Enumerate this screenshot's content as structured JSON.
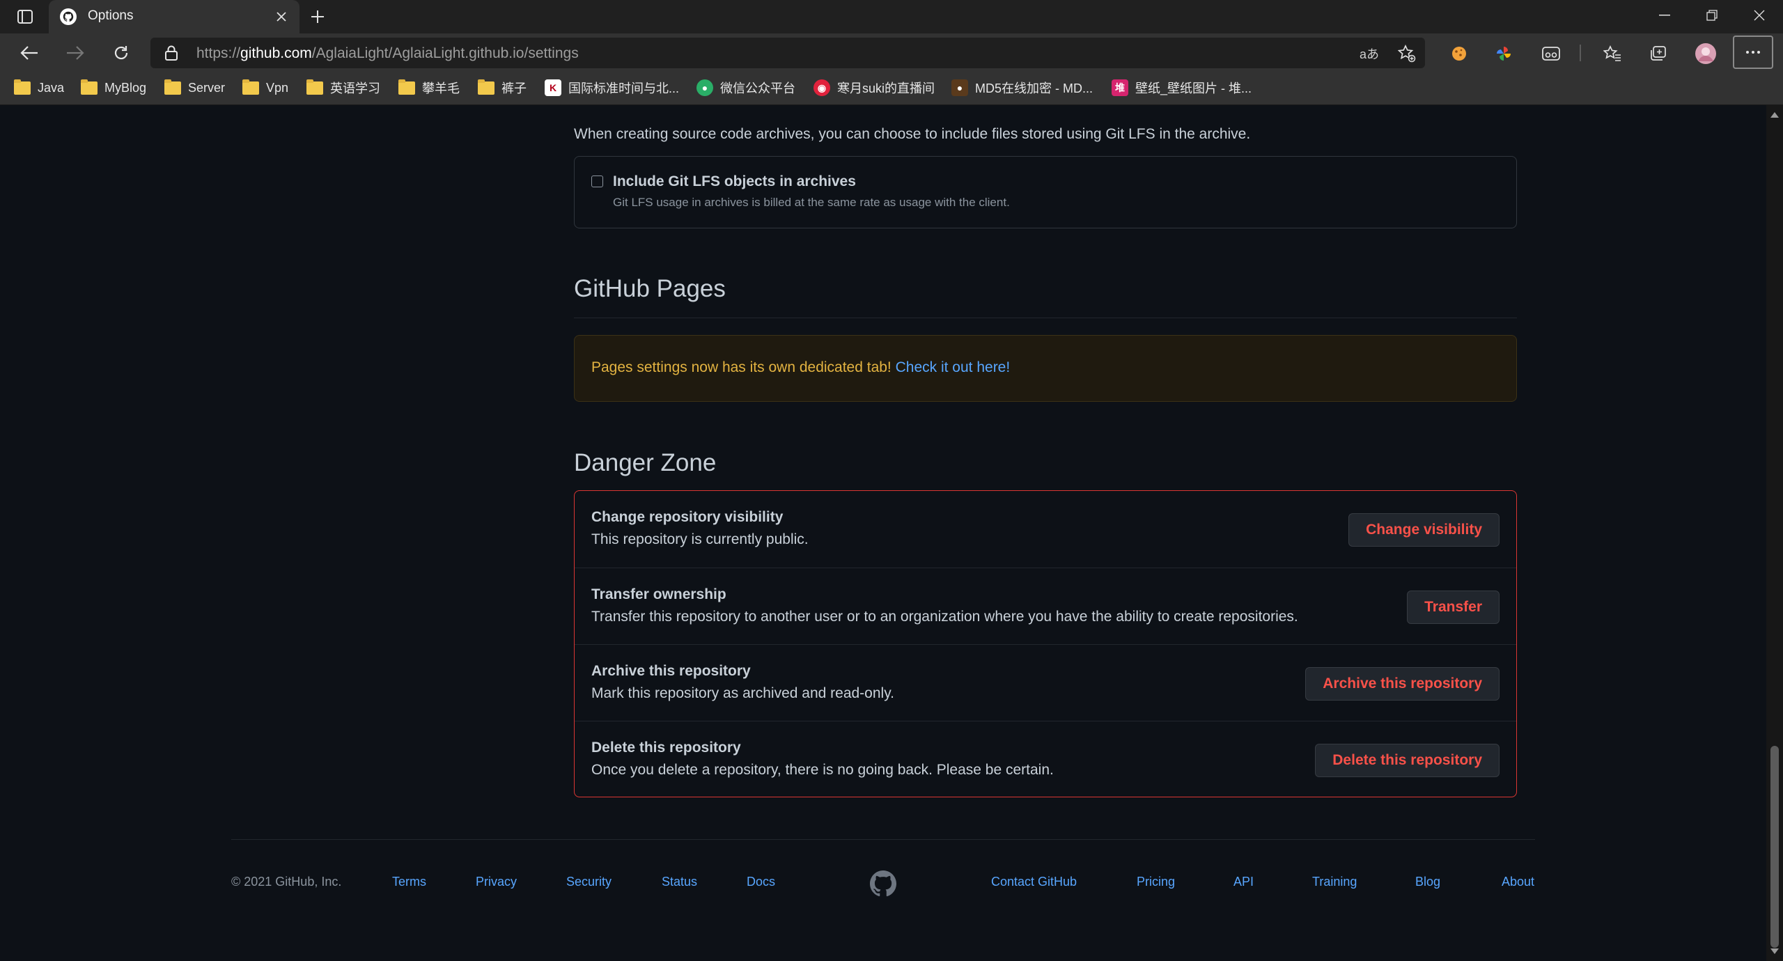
{
  "browser": {
    "tab_title": "Options",
    "url_scheme": "https://",
    "url_host": "github.com",
    "url_path": "/AglaiaLight/AglaiaLight.github.io/settings",
    "bookmarks": [
      {
        "label": "Java",
        "icon": "folder-icon"
      },
      {
        "label": "MyBlog",
        "icon": "folder-icon"
      },
      {
        "label": "Server",
        "icon": "folder-icon"
      },
      {
        "label": "Vpn",
        "icon": "folder-icon"
      },
      {
        "label": "英语学习",
        "icon": "folder-icon"
      },
      {
        "label": "攀羊毛",
        "icon": "folder-icon"
      },
      {
        "label": "裤子",
        "icon": "folder-icon"
      },
      {
        "label": "国际标准时间与北...",
        "icon": "time-site-icon"
      },
      {
        "label": "微信公众平台",
        "icon": "wechat-icon"
      },
      {
        "label": "寒月suki的直播间",
        "icon": "live-icon"
      },
      {
        "label": "MD5在线加密 - MD...",
        "icon": "md5-site-icon"
      },
      {
        "label": "壁纸_壁纸图片 - 堆...",
        "icon": "wallpaper-site-icon"
      }
    ],
    "colors": {
      "chrome_dark": "#202020",
      "chrome": "#323232"
    }
  },
  "lfs": {
    "intro": "When creating source code archives, you can choose to include files stored using Git LFS in the archive.",
    "checkbox_label": "Include Git LFS objects in archives",
    "checkbox_checked": false,
    "note": "Git LFS usage in archives is billed at the same rate as usage with the client."
  },
  "pages": {
    "heading": "GitHub Pages",
    "flash_text": "Pages settings now has its own dedicated tab! ",
    "flash_link": "Check it out here!"
  },
  "danger": {
    "heading": "Danger Zone",
    "rows": [
      {
        "title": "Change repository visibility",
        "desc": "This repository is currently public.",
        "button": "Change visibility"
      },
      {
        "title": "Transfer ownership",
        "desc": "Transfer this repository to another user or to an organization where you have the ability to create repositories.",
        "button": "Transfer"
      },
      {
        "title": "Archive this repository",
        "desc": "Mark this repository as archived and read-only.",
        "button": "Archive this repository"
      },
      {
        "title": "Delete this repository",
        "desc": "Once you delete a repository, there is no going back. Please be certain.",
        "button": "Delete this repository"
      }
    ],
    "colors": {
      "border": "#da3633",
      "button_text": "#f85149"
    }
  },
  "footer": {
    "copyright": "© 2021 GitHub, Inc.",
    "left_links": [
      "Terms",
      "Privacy",
      "Security",
      "Status",
      "Docs"
    ],
    "right_links": [
      "Contact GitHub",
      "Pricing",
      "API",
      "Training",
      "Blog",
      "About"
    ],
    "logo_icon": "github-mark-icon"
  },
  "theme": {
    "page_bg": "#0d1117",
    "text": "#c9d1d9",
    "muted": "#8b949e",
    "link": "#58a6ff",
    "warning_text": "#e3b341"
  }
}
